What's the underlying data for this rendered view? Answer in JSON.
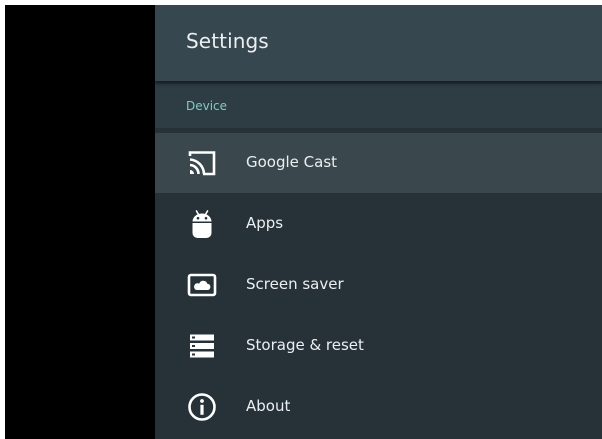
{
  "header": {
    "title": "Settings"
  },
  "section": {
    "label": "Device"
  },
  "menu": {
    "items": [
      {
        "label": "Google Cast",
        "icon": "cast-icon",
        "focused": true
      },
      {
        "label": "Apps",
        "icon": "android-icon",
        "focused": false
      },
      {
        "label": "Screen saver",
        "icon": "screen-saver-icon",
        "focused": false
      },
      {
        "label": "Storage & reset",
        "icon": "storage-icon",
        "focused": false
      },
      {
        "label": "About",
        "icon": "info-icon",
        "focused": false
      }
    ]
  },
  "colors": {
    "panel_background": "#263238",
    "header_background": "#37474f",
    "focused_row": "#3a474d",
    "section_accent": "#80cbc4",
    "text": "#eceff1",
    "letterbox": "#000000"
  }
}
